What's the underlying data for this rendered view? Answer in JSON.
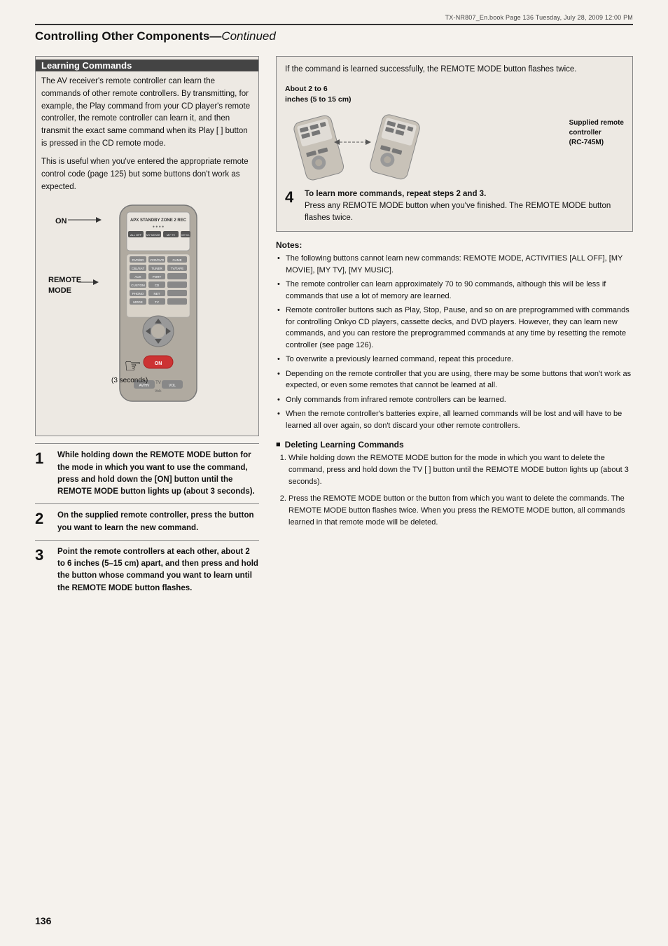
{
  "page": {
    "file_info": "TX-NR807_En.book   Page 136   Tuesday, July 28, 2009   12:00 PM",
    "page_number": "136",
    "header_title": "Controlling Other Components",
    "header_subtitle": "Continued"
  },
  "learning_commands": {
    "box_title": "Learning Commands",
    "intro": "The AV receiver's remote controller can learn the commands of other remote controllers. By transmitting, for example, the Play command from your CD player's remote controller, the remote controller can learn it, and then transmit the exact same command when its Play [    ] button is pressed in the CD remote mode.",
    "intro2": "This is useful when you've entered the appropriate remote control code (page 125) but some buttons don't work as expected.",
    "remote_labels": {
      "on": "ON",
      "remote_mode": "REMOTE\nMODE"
    }
  },
  "steps": {
    "step1": {
      "number": "1",
      "text": "While holding down the REMOTE MODE button for the mode in which you want to use the command, press and hold down the [ON] button until the REMOTE MODE button lights up (about 3 seconds).",
      "sub": "(3 seconds)"
    },
    "step2": {
      "number": "2",
      "text": "On the supplied remote controller, press the button you want to learn the new command."
    },
    "step3": {
      "number": "3",
      "text": "Point the remote controllers at each other, about 2 to 6 inches (5–15 cm) apart, and then press and hold the button whose command you want to learn until the REMOTE MODE button flashes."
    },
    "step4": {
      "number": "4",
      "title": "To learn more commands, repeat steps 2 and 3.",
      "text": "Press any REMOTE MODE button when you've finished. The REMOTE MODE button flashes twice."
    },
    "success_text": "If the command is learned successfully, the REMOTE MODE button flashes twice.",
    "distance_label": "About 2 to 6\ninches (5 to 15 cm)",
    "supplied_label": "Supplied remote\ncontroller\n(RC-745M)"
  },
  "notes": {
    "title": "Notes:",
    "items": [
      "The following buttons cannot learn new commands: REMOTE MODE, ACTIVITIES [ALL OFF], [MY MOVIE], [MY TV], [MY MUSIC].",
      "The remote controller can learn approximately 70 to 90 commands, although this will be less if commands that use a lot of memory are learned.",
      "Remote controller buttons such as Play, Stop, Pause, and so on are preprogrammed with commands for controlling Onkyo CD players, cassette decks, and DVD players. However, they can learn new commands, and you can restore the preprogrammed commands at any time by resetting the remote controller (see page 126).",
      "To overwrite a previously learned command, repeat this procedure.",
      "Depending on the remote controller that you are using, there may be some buttons that won't work as expected, or even some remotes that cannot be learned at all.",
      "Only commands from infrared remote controllers can be learned.",
      "When the remote controller's batteries expire, all learned commands will be lost and will have to be learned all over again, so don't discard your other remote controllers."
    ]
  },
  "deleting": {
    "title": "Deleting Learning Commands",
    "items": [
      "While holding down the REMOTE MODE button for the mode in which you want to delete the command, press and hold down the TV [    ] button until the REMOTE MODE button lights up (about 3 seconds).",
      "Press the REMOTE MODE button or the button from which you want to delete the commands. The REMOTE MODE button flashes twice. When you press the REMOTE MODE button, all commands learned in that remote mode will be deleted."
    ]
  }
}
